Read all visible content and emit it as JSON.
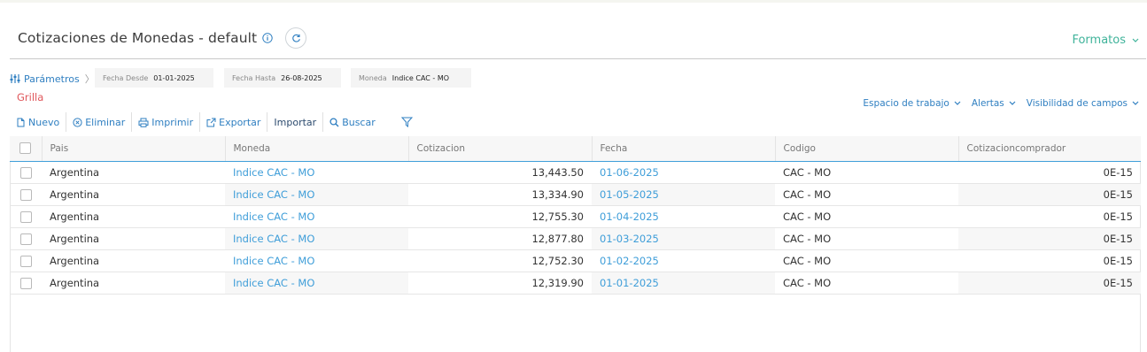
{
  "header": {
    "title": "Cotizaciones de Monedas - default",
    "formatos_label": "Formatos"
  },
  "filters": {
    "params_label": "Parámetros",
    "chips": [
      {
        "label": "Fecha Desde",
        "value": "01-01-2025"
      },
      {
        "label": "Fecha Hasta",
        "value": "26-08-2025"
      },
      {
        "label": "Moneda",
        "value": "Indice CAC - MO"
      }
    ]
  },
  "section_label": "Grilla",
  "workspace": {
    "espacio_label": "Espacio de trabajo",
    "alertas_label": "Alertas",
    "visibilidad_label": "Visibilidad de campos"
  },
  "toolbar": {
    "nuevo": "Nuevo",
    "eliminar": "Eliminar",
    "imprimir": "Imprimir",
    "exportar": "Exportar",
    "importar": "Importar",
    "buscar": "Buscar"
  },
  "colors": {
    "accent_blue": "#3f9ed9",
    "link_blue": "#2f7fc1",
    "formatos_green": "#3fb39a",
    "grilla_red": "#e0575b"
  },
  "table": {
    "columns": [
      "Pais",
      "Moneda",
      "Cotizacion",
      "Fecha",
      "Codigo",
      "Cotizacioncomprador"
    ],
    "rows": [
      [
        "Argentina",
        "Indice CAC - MO",
        "13,443.50",
        "01-06-2025",
        "CAC - MO",
        "0E-15"
      ],
      [
        "Argentina",
        "Indice CAC - MO",
        "13,334.90",
        "01-05-2025",
        "CAC - MO",
        "0E-15"
      ],
      [
        "Argentina",
        "Indice CAC - MO",
        "12,755.30",
        "01-04-2025",
        "CAC - MO",
        "0E-15"
      ],
      [
        "Argentina",
        "Indice CAC - MO",
        "12,877.80",
        "01-03-2025",
        "CAC - MO",
        "0E-15"
      ],
      [
        "Argentina",
        "Indice CAC - MO",
        "12,752.30",
        "01-02-2025",
        "CAC - MO",
        "0E-15"
      ],
      [
        "Argentina",
        "Indice CAC - MO",
        "12,319.90",
        "01-01-2025",
        "CAC - MO",
        "0E-15"
      ]
    ]
  }
}
